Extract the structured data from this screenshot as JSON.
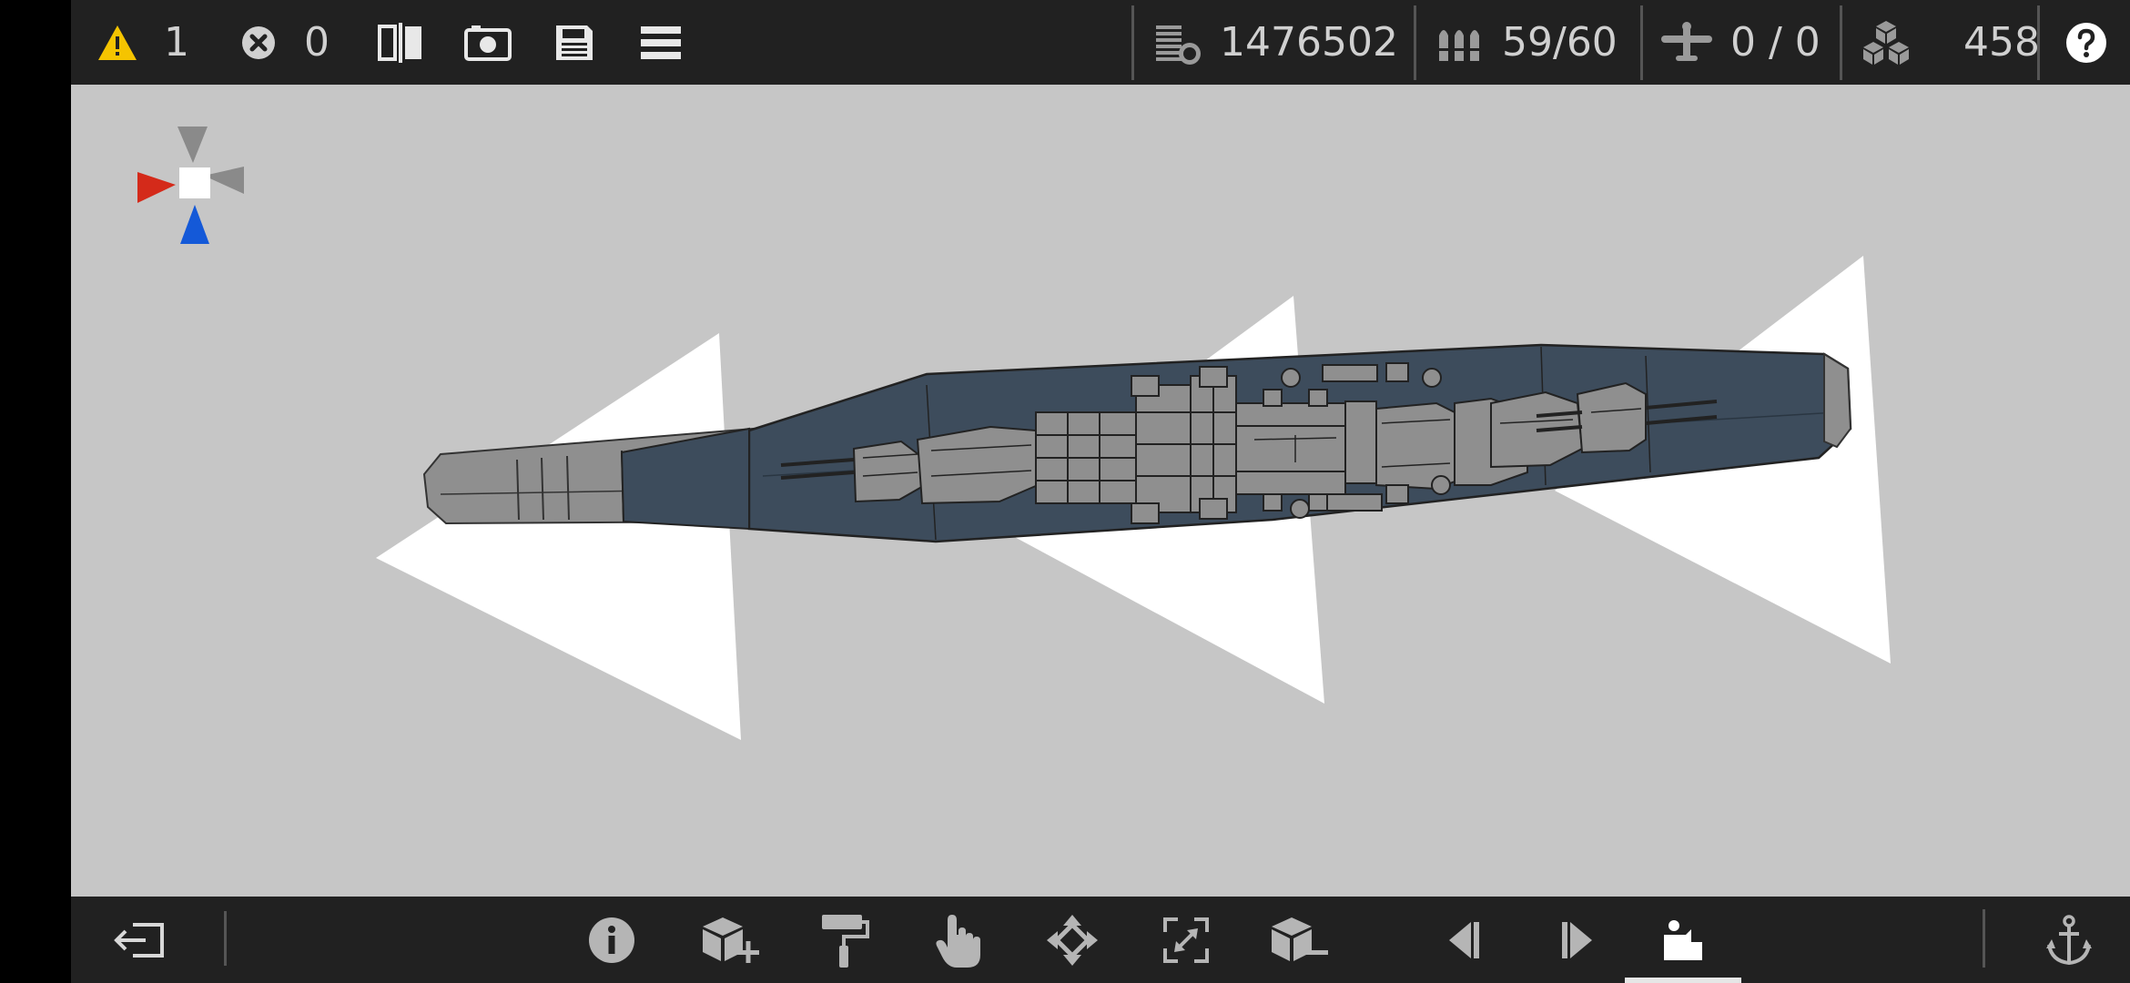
{
  "top_bar": {
    "warnings_count": "1",
    "errors_count": "0",
    "cost_value": "1476502",
    "ammo_value": "59/60",
    "aircraft_value": "0 / 0",
    "parts_value": "458"
  },
  "icons": {
    "warning": "warning-icon",
    "error": "error-icon",
    "mirror": "mirror-icon",
    "camera": "camera-icon",
    "save": "save-icon",
    "menu": "menu-icon",
    "cost": "coins-icon",
    "ammo": "ammo-icon",
    "aircraft": "aircraft-icon",
    "parts": "blocks-icon",
    "help": "help-icon",
    "exit": "exit-icon",
    "info": "info-icon",
    "add_block": "add-block-icon",
    "paint": "paint-roller-icon",
    "select": "hand-pointer-icon",
    "move": "move-arrows-icon",
    "resize": "resize-icon",
    "remove_block": "remove-block-icon",
    "prev": "previous-icon",
    "next": "next-icon",
    "parts_tool": "parts-tool-icon",
    "anchor": "anchor-icon"
  },
  "colors": {
    "warning": "#f5c400",
    "axis_red": "#d42a1a",
    "axis_blue": "#1459d8",
    "hull": "#3d4c5c",
    "viewport_bg": "#c6c6c6"
  }
}
